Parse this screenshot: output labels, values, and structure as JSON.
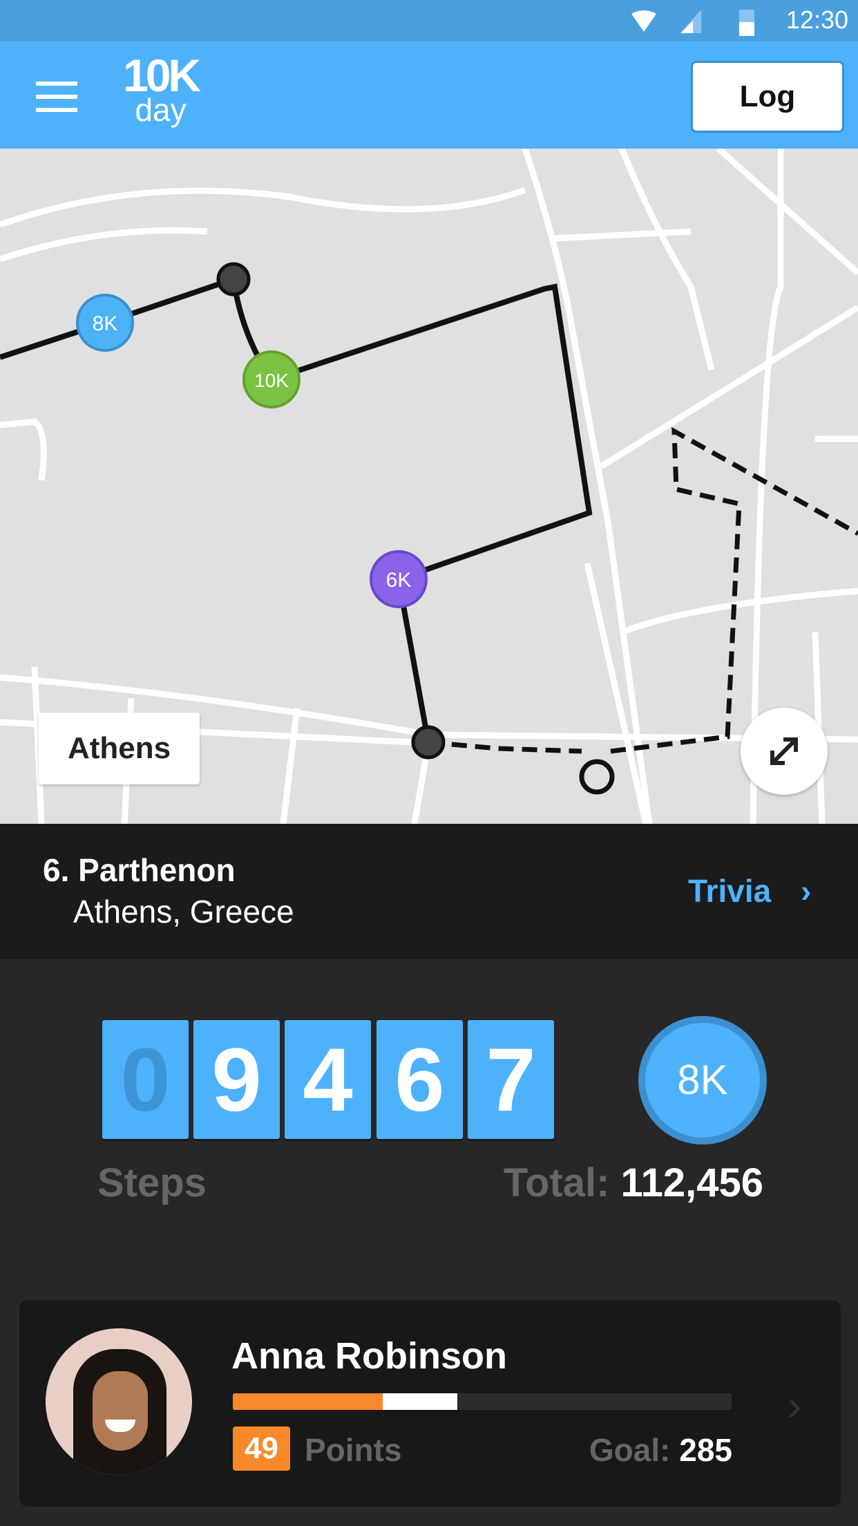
{
  "status_bar": {
    "time": "12:30",
    "icons": [
      "wifi-icon",
      "signal-icon",
      "battery-icon"
    ]
  },
  "app_bar": {
    "logo_top": "10K",
    "logo_bottom": "day",
    "log_button": "Log",
    "menu_icon": "hamburger-menu-icon"
  },
  "map": {
    "city_label": "Athens",
    "milestones": [
      {
        "label": "8K",
        "color": "#4db2f5"
      },
      {
        "label": "10K",
        "color": "#7cc242"
      },
      {
        "label": "6K",
        "color": "#8a63e8"
      }
    ],
    "expand_icon": "expand-arrows-icon"
  },
  "place": {
    "title": "6. Parthenon",
    "subtitle": "Athens, Greece",
    "trivia_label": "Trivia"
  },
  "steps": {
    "digits": [
      "0",
      "9",
      "4",
      "6",
      "7"
    ],
    "label": "Steps",
    "total_label": "Total:",
    "total_value": "112,456",
    "badge": "8K"
  },
  "user": {
    "name": "Anna Robinson",
    "points": "49",
    "points_label": "Points",
    "goal_label": "Goal:",
    "goal_value": "285",
    "progress_primary": 0.3,
    "progress_secondary": 0.45
  },
  "colors": {
    "accent": "#4db2fb",
    "orange": "#f7892a",
    "background": "#272727"
  }
}
